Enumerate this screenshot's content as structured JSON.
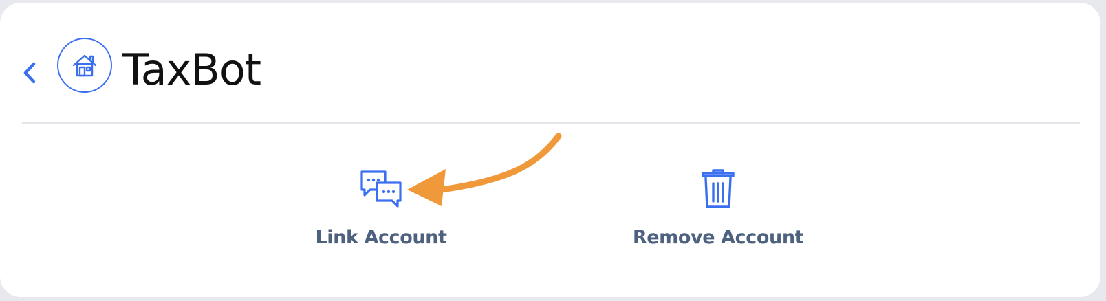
{
  "header": {
    "title": "TaxBot",
    "back_icon": "chevron-left-icon",
    "avatar_icon": "house-icon"
  },
  "actions": [
    {
      "label": "Link Account",
      "icon": "chat-bubbles-icon"
    },
    {
      "label": "Remove Account",
      "icon": "trash-icon"
    }
  ],
  "annotation": {
    "icon": "orange-arrow-icon",
    "color": "#f0993a"
  },
  "colors": {
    "accent": "#3a6ff0",
    "label": "#4e6280",
    "title": "#111111",
    "background": "#e8e9ee",
    "card": "#ffffff"
  }
}
